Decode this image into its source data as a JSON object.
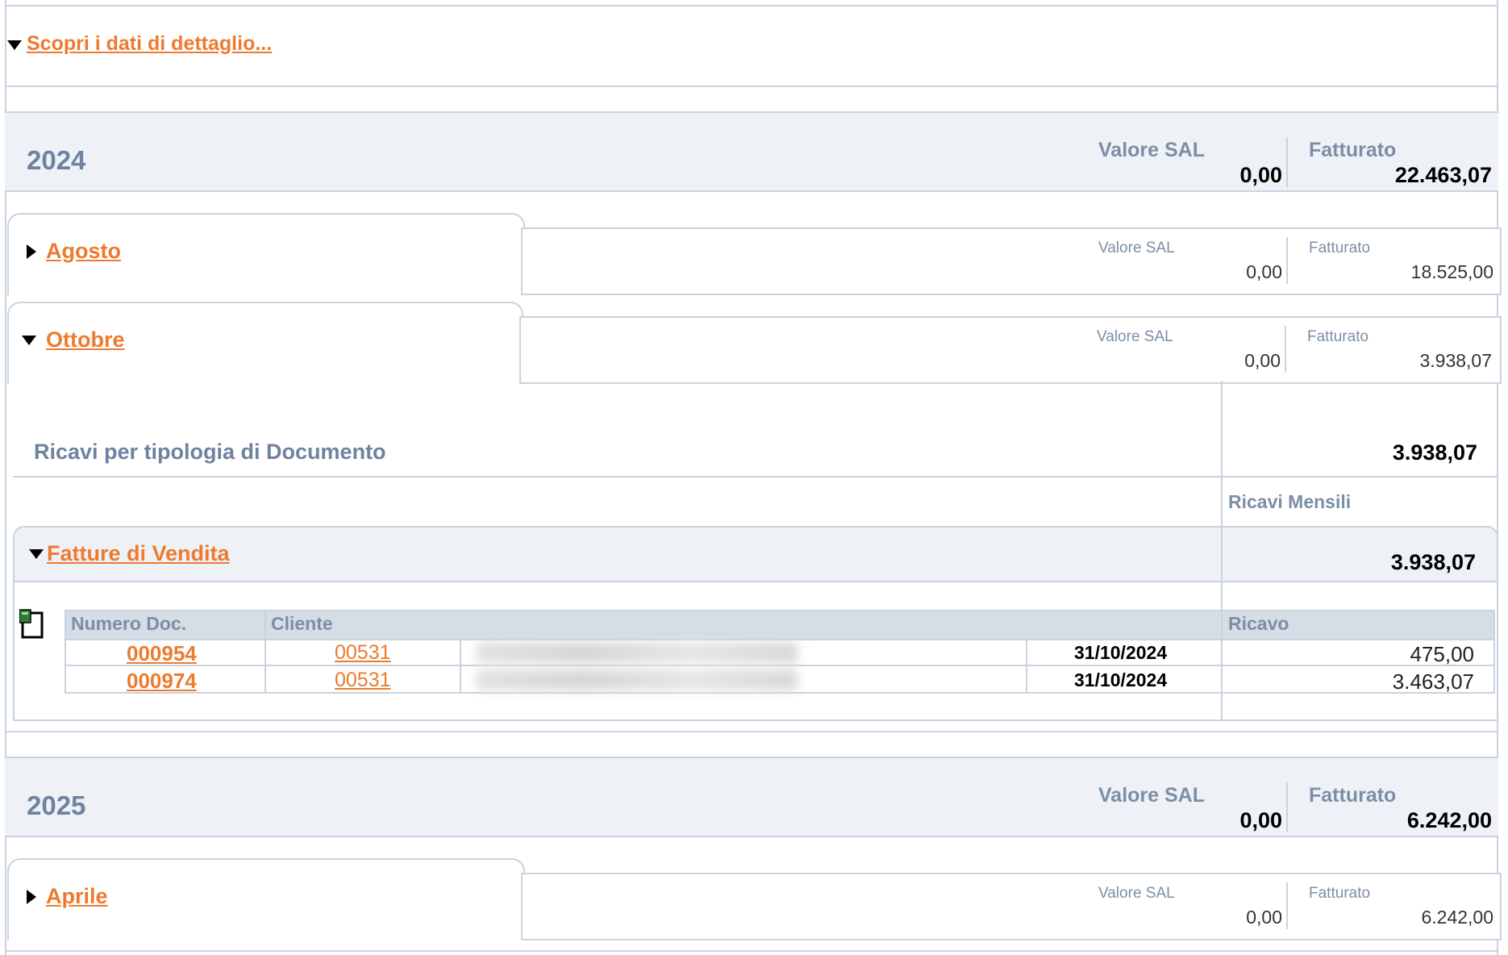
{
  "detail_link": "Scopri i dati di dettaglio...",
  "labels": {
    "valore_sal": "Valore SAL",
    "fatturato": "Fatturato"
  },
  "years": [
    {
      "year": "2024",
      "valore_sal": "0,00",
      "fatturato": "22.463,07",
      "months": [
        {
          "name": "Agosto",
          "valore_sal": "0,00",
          "fatturato": "18.525,00",
          "expanded": false
        },
        {
          "name": "Ottobre",
          "valore_sal": "0,00",
          "fatturato": "3.938,07",
          "expanded": true
        }
      ]
    },
    {
      "year": "2025",
      "valore_sal": "0,00",
      "fatturato": "6.242,00",
      "months": [
        {
          "name": "Aprile",
          "valore_sal": "0,00",
          "fatturato": "6.242,00",
          "expanded": false
        }
      ]
    }
  ],
  "ottobre_detail": {
    "section_title": "Ricavi per tipologia di Documento",
    "section_total": "3.938,07",
    "monthly_label": "Ricavi Mensili",
    "group_title": "Fatture di Vendita",
    "group_total": "3.938,07",
    "columns": [
      "Numero Doc.",
      "Cliente",
      "Ricavo"
    ],
    "rows": [
      {
        "numero": "000954",
        "cliente": "00531",
        "data": "31/10/2024",
        "ricavo": "475,00"
      },
      {
        "numero": "000974",
        "cliente": "00531",
        "data": "31/10/2024",
        "ricavo": "3.463,07"
      }
    ]
  },
  "icons": {
    "export": "document-export-icon"
  }
}
